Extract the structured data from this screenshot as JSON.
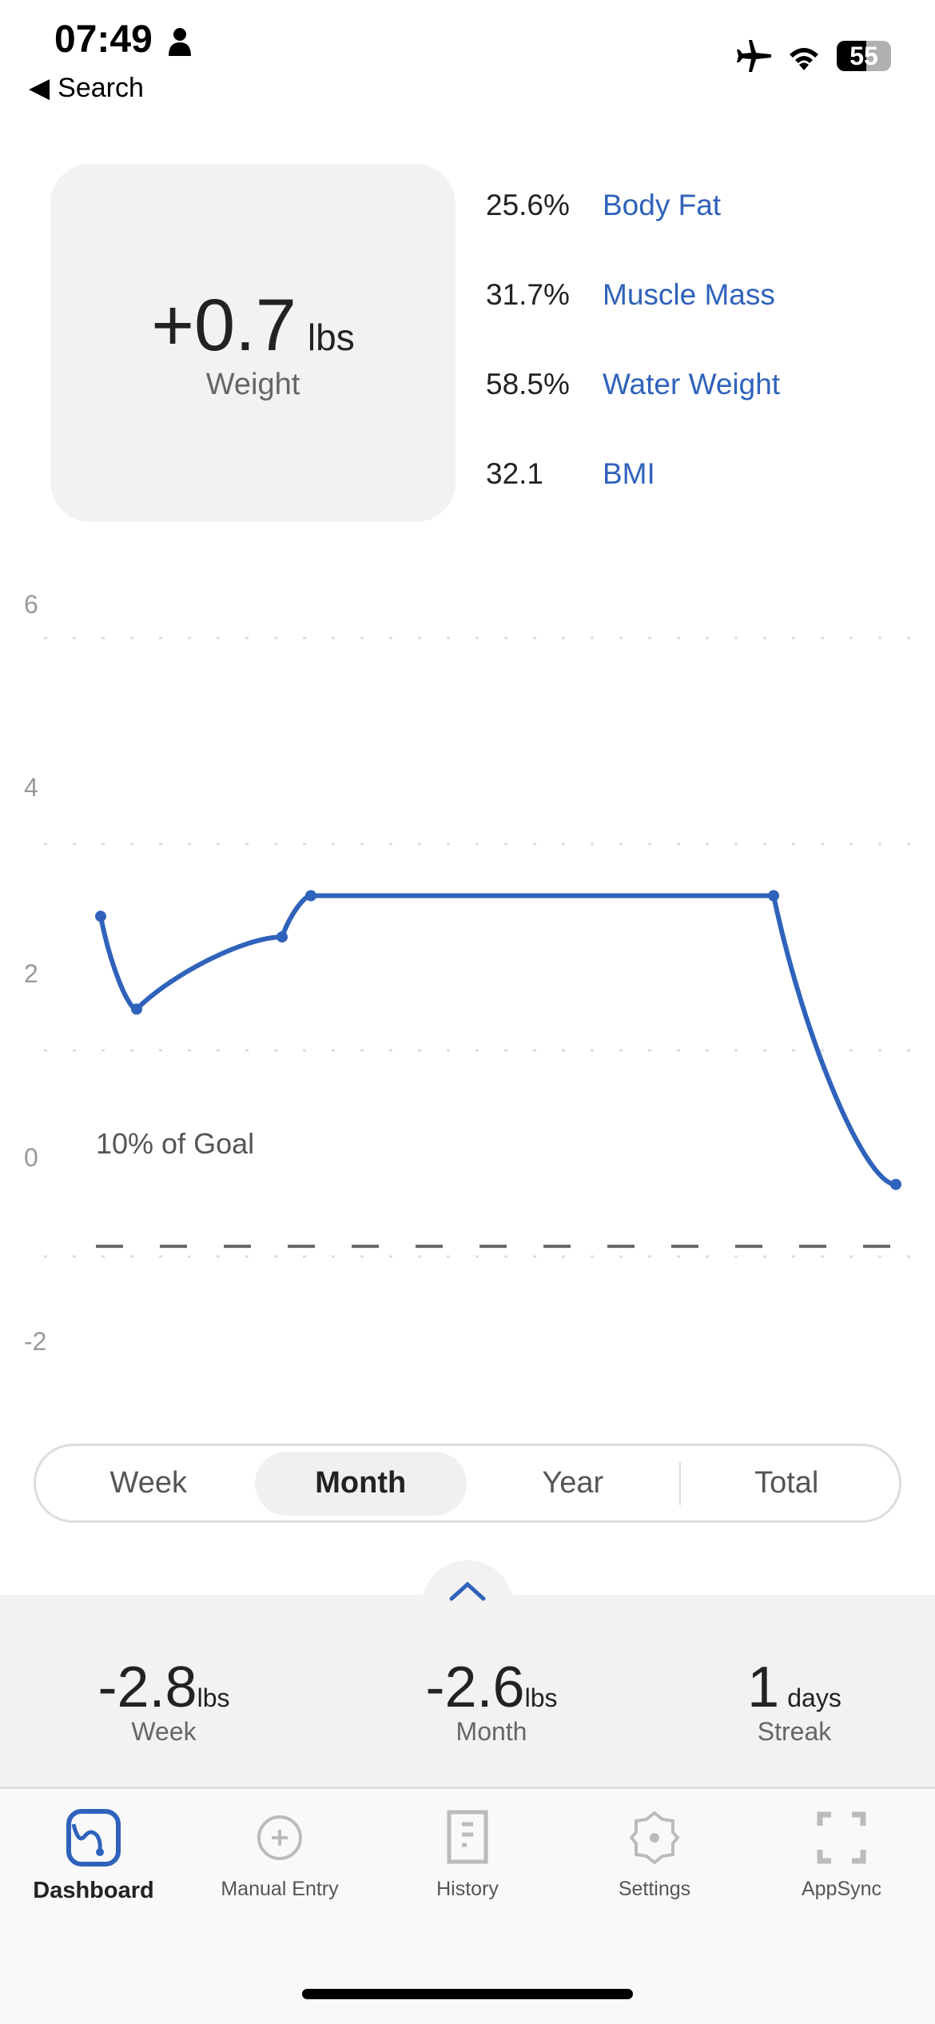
{
  "status_bar": {
    "time": "07:49",
    "battery": "55",
    "back_label": "Search"
  },
  "summary_card": {
    "value": "+0.7",
    "unit": "lbs",
    "label": "Weight"
  },
  "metrics": [
    {
      "value": "25.6%",
      "label": "Body Fat"
    },
    {
      "value": "31.7%",
      "label": "Muscle Mass"
    },
    {
      "value": "58.5%",
      "label": "Water Weight"
    },
    {
      "value": "32.1",
      "label": "BMI"
    }
  ],
  "chart_data": {
    "type": "line",
    "yticks": [
      "6",
      "4",
      "2",
      "0",
      "-2"
    ],
    "ylim": [
      -2,
      6
    ],
    "grid": true,
    "series": [
      {
        "values": [
          3.3,
          2.4,
          3.1,
          3.5,
          3.5,
          0.7
        ],
        "color": "#2f62bb"
      }
    ],
    "goal_line": {
      "value": 0.1,
      "label": "10% of Goal",
      "color": "#666666"
    }
  },
  "range_selector": {
    "options": [
      "Week",
      "Month",
      "Year",
      "Total"
    ],
    "selected": "Month"
  },
  "totals": [
    {
      "value": "-2.8",
      "unit": "lbs",
      "label": "Week"
    },
    {
      "value": "-2.6",
      "unit": "lbs",
      "label": "Month"
    },
    {
      "value": "1",
      "unit": "days",
      "label": "Streak"
    }
  ],
  "tabs": [
    {
      "label": "Dashboard",
      "icon": "dashboard-icon",
      "active": true
    },
    {
      "label": "Manual Entry",
      "icon": "plus-circle-icon"
    },
    {
      "label": "History",
      "icon": "document-icon"
    },
    {
      "label": "Settings",
      "icon": "gear-icon"
    },
    {
      "label": "AppSync",
      "icon": "scan-frame-icon"
    }
  ],
  "accent": "#2f62bb"
}
